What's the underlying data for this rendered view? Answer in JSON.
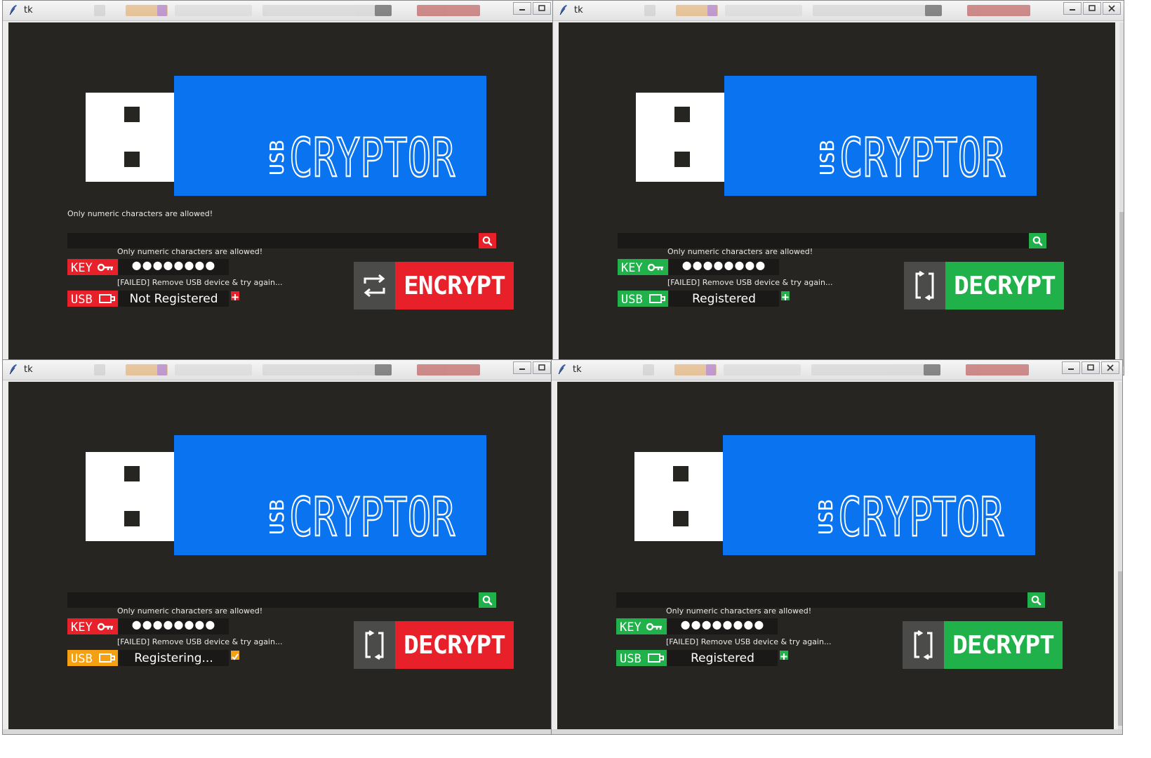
{
  "colors": {
    "red": "#e8202a",
    "green": "#21b14a",
    "orange": "#f5a012",
    "blue": "#0a74f0",
    "bg": "#262522",
    "field": "#1a1917",
    "gray": "#4b4b4a"
  },
  "windows": [
    {
      "title": "tk",
      "brand": {
        "small": "USB",
        "big": "CRYPTOR"
      },
      "search_hint": "Only numeric characters are allowed!",
      "key_hint": "Only numeric characters are allowed!",
      "password": "●●●●●●●●",
      "usb_hint": "[FAILED] Remove USB device & try again...",
      "key_label": "KEY",
      "usb_label": "USB",
      "status": "Not Registered",
      "key_color": "red",
      "usb_color": "red",
      "search_color": "red",
      "action_color": "red",
      "side_icon": "plus-icon",
      "action": "ENCRYPT",
      "action_icon": "repeat-icon"
    },
    {
      "title": "tk",
      "brand": {
        "small": "USB",
        "big": "CRYPTOR"
      },
      "search_hint": "",
      "key_hint": "Only numeric characters are allowed!",
      "password": "●●●●●●●●",
      "usb_hint": "[FAILED] Remove USB device & try again...",
      "key_label": "KEY",
      "usb_label": "USB",
      "status": "Registered",
      "key_color": "green",
      "usb_color": "green",
      "search_color": "green",
      "action_color": "green",
      "side_icon": "plus-icon",
      "action": "DECRYPT",
      "action_icon": "bracket-swap-icon"
    },
    {
      "title": "tk",
      "brand": {
        "small": "USB",
        "big": "CRYPTOR"
      },
      "search_hint": "",
      "key_hint": "Only numeric characters are allowed!",
      "password": "●●●●●●●●",
      "usb_hint": "[FAILED] Remove USB device & try again...",
      "key_label": "KEY",
      "usb_label": "USB",
      "status": "Registering...",
      "key_color": "red",
      "usb_color": "orange",
      "search_color": "green",
      "action_color": "red",
      "side_icon": "check-icon",
      "action": "DECRYPT",
      "action_icon": "bracket-swap-icon"
    },
    {
      "title": "tk",
      "brand": {
        "small": "USB",
        "big": "CRYPTOR"
      },
      "search_hint": "",
      "key_hint": "Only numeric characters are allowed!",
      "password": "●●●●●●●●",
      "usb_hint": "[FAILED] Remove USB device & try again...",
      "key_label": "KEY",
      "usb_label": "USB",
      "status": "Registered",
      "key_color": "green",
      "usb_color": "green",
      "search_color": "green",
      "action_color": "green",
      "side_icon": "plus-icon",
      "action": "DECRYPT",
      "action_icon": "bracket-swap-icon"
    }
  ]
}
